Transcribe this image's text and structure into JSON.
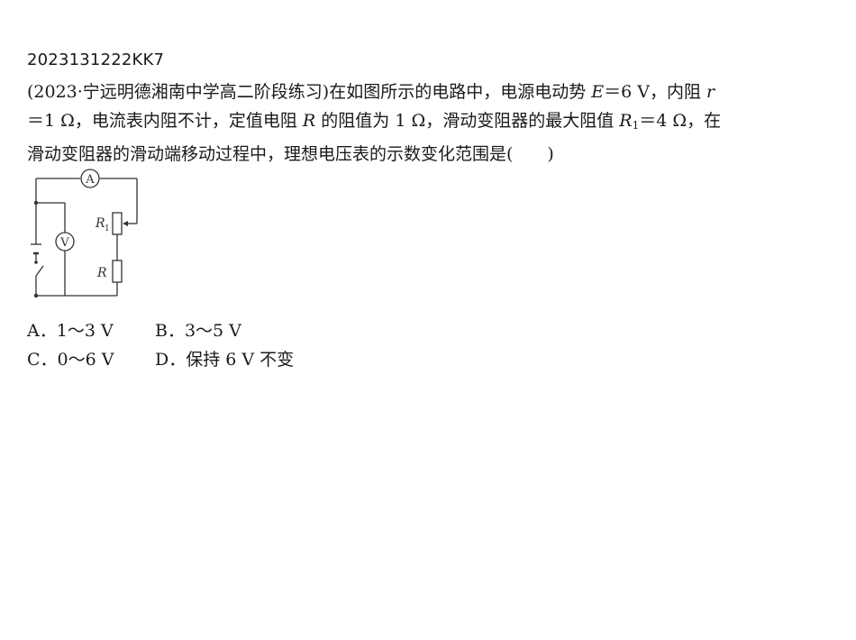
{
  "question": {
    "id": "2023131222KK7",
    "line1": {
      "prefix": "(2023·宁远明德湘南中学高二阶段练习)在如图所示的电路中，电源电动势 ",
      "sym_E": "E",
      "mid": "＝6 V，内阻 ",
      "sym_r": "r"
    },
    "line2": {
      "a": "＝1 Ω，电流表内阻不计，定值电阻 ",
      "sym_R": "R",
      "b": " 的阻值为 1 Ω，滑动变阻器的最大阻值 ",
      "sym_R1": "R",
      "sub_1": "1",
      "c": "＝4 Ω，在"
    },
    "line3": "滑动变阻器的滑动端移动过程中，理想电压表的示数变化范围是(　　)"
  },
  "circuit": {
    "ammeter_label": "A",
    "voltmeter_label": "V",
    "r1_label": "R",
    "r1_sub": "1",
    "r_label": "R",
    "wire_color": "#333333"
  },
  "options": [
    {
      "letter": "A．",
      "text": "1～3 V"
    },
    {
      "letter": "B．",
      "text": "3～5 V"
    },
    {
      "letter": "C．",
      "text": "0～6 V"
    },
    {
      "letter": "D．",
      "text": "保持 6 V 不变"
    }
  ]
}
